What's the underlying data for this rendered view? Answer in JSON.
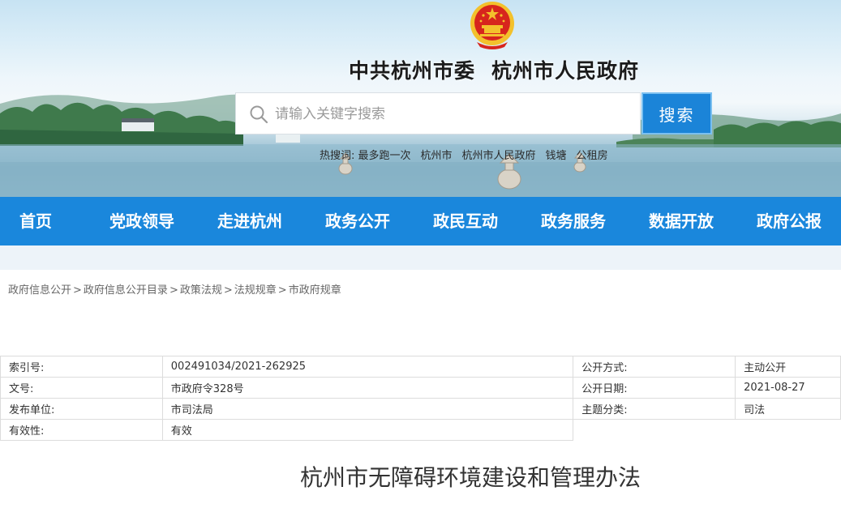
{
  "header": {
    "title_part1": "中共杭州市委",
    "title_part2": "杭州市人民政府",
    "search": {
      "placeholder": "请输入关键字搜索",
      "button_label": "搜索",
      "hotwords": [
        "热搜词: 最多跑一次",
        "杭州市",
        "杭州市人民政府",
        "钱塘",
        "公租房"
      ]
    }
  },
  "nav": {
    "items": [
      "首页",
      "党政领导",
      "走进杭州",
      "政务公开",
      "政民互动",
      "政务服务",
      "数据开放",
      "政府公报"
    ]
  },
  "breadcrumb": [
    "政府信息公开",
    "政府信息公开目录",
    "政策法规",
    "法规规章",
    "市政府规章"
  ],
  "meta": {
    "index_label": "索引号:",
    "index_value": "002491034/2021-262925",
    "method_label": "公开方式:",
    "method_value": "主动公开",
    "doc_no_label": "文号:",
    "doc_no_value": "市政府令328号",
    "date_label": "公开日期:",
    "date_value": "2021-08-27",
    "publisher_label": "发布单位:",
    "publisher_value": "市司法局",
    "topic_label": "主题分类:",
    "topic_value": "司法",
    "validity_label": "有效性:",
    "validity_value": "有效"
  },
  "document": {
    "title": "杭州市无障碍环境建设和管理办法"
  },
  "colors": {
    "nav_blue": "#1a87dc",
    "button_blue": "#1b84d8",
    "emblem_red": "#d7251d",
    "emblem_gold": "#f3c12c"
  },
  "icons": {
    "search": "search-icon",
    "emblem": "national-emblem-icon"
  }
}
